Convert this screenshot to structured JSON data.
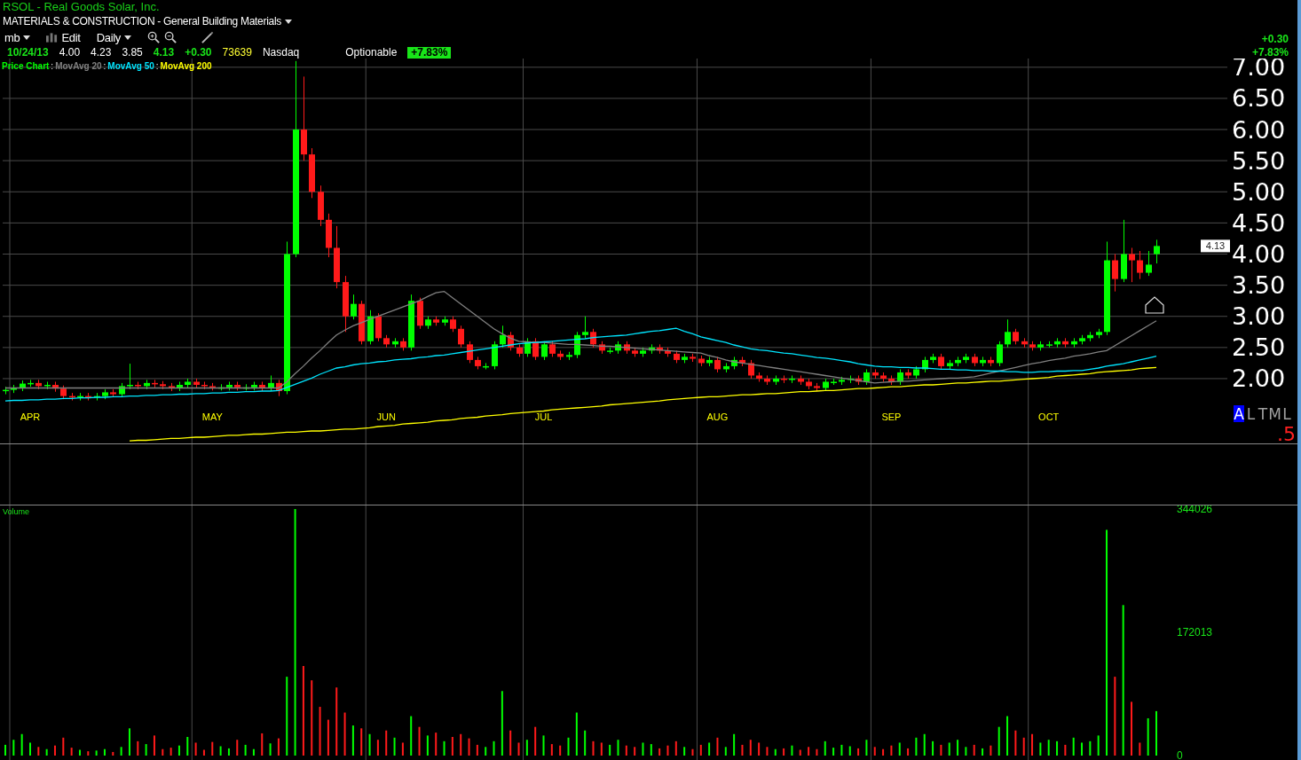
{
  "header": {
    "title": "RSOL - Real Goods Solar, Inc.",
    "sector": "MATERIALS & CONSTRUCTION - General Building Materials"
  },
  "toolbar": {
    "account": "mb",
    "edit": "Edit",
    "period": "Daily"
  },
  "quote": {
    "date": "10/24/13",
    "open": "4.00",
    "high": "4.23",
    "low": "3.85",
    "last": "4.13",
    "change": "+0.30",
    "volume": "73639",
    "exchange": "Nasdaq",
    "optionable": "Optionable",
    "change_pct": "+7.83%"
  },
  "change_box": {
    "change": "+0.30",
    "change_pct": "+7.83%"
  },
  "price_chart": {
    "legend_separator": ":",
    "chart_data": {
      "type": "candlestick",
      "title": "Price Chart",
      "grid": true,
      "ylim": [
        0.96,
        7.14
      ],
      "categories": [
        null,
        null,
        null,
        "APR",
        null,
        null,
        null,
        null,
        null,
        null,
        null,
        null,
        null,
        null,
        null,
        null,
        null,
        null,
        null,
        null,
        null,
        null,
        null,
        null,
        null,
        "MAY",
        null,
        null,
        null,
        null,
        null,
        null,
        null,
        null,
        null,
        null,
        null,
        null,
        null,
        null,
        null,
        null,
        null,
        null,
        null,
        null,
        "JUN",
        null,
        null,
        null,
        null,
        null,
        null,
        null,
        null,
        null,
        null,
        null,
        null,
        null,
        null,
        null,
        null,
        null,
        null,
        "JUL",
        null,
        null,
        null,
        null,
        null,
        null,
        null,
        null,
        null,
        null,
        null,
        null,
        null,
        null,
        null,
        null,
        null,
        null,
        null,
        null,
        "AUG",
        null,
        null,
        null,
        null,
        null,
        null,
        null,
        null,
        null,
        null,
        null,
        null,
        null,
        null,
        null,
        null,
        null,
        null,
        null,
        null,
        "SEP",
        null,
        null,
        null,
        null,
        null,
        null,
        null,
        null,
        null,
        null,
        null,
        null,
        null,
        null,
        null,
        null,
        null,
        null,
        "OCT",
        null,
        null,
        null,
        null,
        null,
        null,
        null,
        null,
        null,
        null,
        null,
        null,
        null
      ],
      "yticks": [
        {
          "value": 2,
          "label": "2.00"
        },
        {
          "value": 2.5,
          "label": "2.50"
        },
        {
          "value": 3,
          "label": "3.00"
        },
        {
          "value": 3.5,
          "label": "3.50"
        },
        {
          "value": 4,
          "label": "4.00"
        },
        {
          "value": 4.5,
          "label": "4.50"
        },
        {
          "value": 5,
          "label": "5.00"
        },
        {
          "value": 5.5,
          "label": "5.50"
        },
        {
          "value": 6,
          "label": "6.00"
        },
        {
          "value": 6.5,
          "label": "6.50"
        },
        {
          "value": 7,
          "label": "7.00"
        }
      ],
      "ohlc": [
        [
          1.8,
          1.87,
          1.75,
          1.82
        ],
        [
          1.82,
          1.9,
          1.77,
          1.85
        ],
        [
          1.85,
          1.97,
          1.8,
          1.92
        ],
        [
          1.92,
          1.98,
          1.87,
          1.93
        ],
        [
          1.93,
          1.98,
          1.83,
          1.88
        ],
        [
          1.88,
          1.95,
          1.83,
          1.9
        ],
        [
          1.9,
          1.95,
          1.79,
          1.84
        ],
        [
          1.84,
          1.89,
          1.67,
          1.72
        ],
        [
          1.72,
          1.77,
          1.65,
          1.7
        ],
        [
          1.7,
          1.77,
          1.65,
          1.72
        ],
        [
          1.72,
          1.77,
          1.65,
          1.7
        ],
        [
          1.7,
          1.77,
          1.65,
          1.72
        ],
        [
          1.72,
          1.83,
          1.67,
          1.78
        ],
        [
          1.78,
          1.83,
          1.7,
          1.75
        ],
        [
          1.75,
          1.93,
          1.7,
          1.88
        ],
        [
          1.88,
          2.24,
          1.83,
          1.9
        ],
        [
          1.9,
          1.95,
          1.83,
          1.88
        ],
        [
          1.88,
          1.98,
          1.83,
          1.93
        ],
        [
          1.93,
          1.98,
          1.86,
          1.91
        ],
        [
          1.91,
          1.96,
          1.83,
          1.88
        ],
        [
          1.88,
          1.93,
          1.8,
          1.85
        ],
        [
          1.85,
          1.95,
          1.8,
          1.9
        ],
        [
          1.9,
          2.0,
          1.85,
          1.95
        ],
        [
          1.95,
          2.0,
          1.85,
          1.9
        ],
        [
          1.9,
          1.95,
          1.83,
          1.88
        ],
        [
          1.88,
          1.93,
          1.81,
          1.86
        ],
        [
          1.86,
          1.91,
          1.81,
          1.86
        ],
        [
          1.86,
          1.95,
          1.81,
          1.9
        ],
        [
          1.9,
          1.95,
          1.81,
          1.86
        ],
        [
          1.86,
          1.91,
          1.81,
          1.86
        ],
        [
          1.86,
          1.95,
          1.81,
          1.9
        ],
        [
          1.9,
          1.95,
          1.8,
          1.85
        ],
        [
          1.85,
          2.05,
          1.8,
          1.93
        ],
        [
          1.93,
          1.98,
          1.72,
          1.8
        ],
        [
          1.8,
          4.2,
          1.75,
          4.0
        ],
        [
          4.0,
          7.1,
          3.95,
          6.0
        ],
        [
          6.0,
          6.85,
          5.5,
          5.6
        ],
        [
          5.6,
          5.7,
          4.9,
          5.0
        ],
        [
          5.0,
          5.1,
          4.45,
          4.55
        ],
        [
          4.55,
          4.65,
          3.95,
          4.1
        ],
        [
          4.1,
          4.45,
          3.45,
          3.55
        ],
        [
          3.55,
          3.65,
          2.75,
          3.0
        ],
        [
          3.0,
          3.35,
          2.95,
          3.2
        ],
        [
          3.2,
          3.25,
          2.55,
          2.6
        ],
        [
          2.6,
          3.1,
          2.55,
          3.0
        ],
        [
          3.0,
          3.05,
          2.6,
          2.65
        ],
        [
          2.65,
          2.7,
          2.5,
          2.55
        ],
        [
          2.55,
          2.65,
          2.5,
          2.6
        ],
        [
          2.6,
          2.65,
          2.45,
          2.5
        ],
        [
          2.5,
          3.35,
          2.45,
          3.25
        ],
        [
          3.25,
          3.3,
          2.8,
          2.85
        ],
        [
          2.85,
          3.0,
          2.8,
          2.95
        ],
        [
          2.95,
          3.0,
          2.85,
          2.9
        ],
        [
          2.9,
          3.0,
          2.85,
          2.95
        ],
        [
          2.95,
          3.0,
          2.75,
          2.8
        ],
        [
          2.8,
          2.85,
          2.5,
          2.55
        ],
        [
          2.55,
          2.6,
          2.25,
          2.3
        ],
        [
          2.3,
          2.35,
          2.15,
          2.2
        ],
        [
          2.2,
          2.25,
          2.15,
          2.2
        ],
        [
          2.2,
          2.6,
          2.15,
          2.55
        ],
        [
          2.55,
          2.85,
          2.5,
          2.7
        ],
        [
          2.7,
          2.75,
          2.45,
          2.5
        ],
        [
          2.5,
          2.55,
          2.35,
          2.4
        ],
        [
          2.4,
          2.65,
          2.35,
          2.6
        ],
        [
          2.6,
          2.65,
          2.3,
          2.35
        ],
        [
          2.35,
          2.6,
          2.3,
          2.55
        ],
        [
          2.55,
          2.6,
          2.35,
          2.4
        ],
        [
          2.4,
          2.45,
          2.3,
          2.35
        ],
        [
          2.35,
          2.43,
          2.3,
          2.38
        ],
        [
          2.38,
          2.75,
          2.33,
          2.7
        ],
        [
          2.7,
          3.0,
          2.65,
          2.75
        ],
        [
          2.75,
          2.8,
          2.5,
          2.55
        ],
        [
          2.55,
          2.6,
          2.4,
          2.45
        ],
        [
          2.45,
          2.5,
          2.4,
          2.45
        ],
        [
          2.45,
          2.6,
          2.4,
          2.55
        ],
        [
          2.55,
          2.6,
          2.4,
          2.45
        ],
        [
          2.45,
          2.5,
          2.35,
          2.4
        ],
        [
          2.4,
          2.5,
          2.35,
          2.45
        ],
        [
          2.45,
          2.55,
          2.4,
          2.5
        ],
        [
          2.5,
          2.55,
          2.4,
          2.45
        ],
        [
          2.45,
          2.5,
          2.35,
          2.4
        ],
        [
          2.4,
          2.45,
          2.25,
          2.3
        ],
        [
          2.3,
          2.4,
          2.25,
          2.35
        ],
        [
          2.35,
          2.4,
          2.27,
          2.32
        ],
        [
          2.32,
          2.37,
          2.2,
          2.25
        ],
        [
          2.25,
          2.35,
          2.2,
          2.3
        ],
        [
          2.3,
          2.35,
          2.1,
          2.15
        ],
        [
          2.15,
          2.25,
          2.1,
          2.2
        ],
        [
          2.2,
          2.35,
          2.15,
          2.3
        ],
        [
          2.3,
          2.35,
          2.2,
          2.25
        ],
        [
          2.25,
          2.3,
          2.0,
          2.05
        ],
        [
          2.05,
          2.1,
          1.95,
          2.0
        ],
        [
          2.0,
          2.05,
          1.9,
          1.95
        ],
        [
          1.95,
          2.05,
          1.9,
          2.0
        ],
        [
          2.0,
          2.05,
          1.93,
          1.98
        ],
        [
          1.98,
          2.05,
          1.93,
          2.0
        ],
        [
          2.0,
          2.05,
          1.9,
          1.95
        ],
        [
          1.95,
          2.0,
          1.83,
          1.88
        ],
        [
          1.88,
          1.93,
          1.8,
          1.85
        ],
        [
          1.85,
          2.0,
          1.8,
          1.95
        ],
        [
          1.95,
          2.0,
          1.9,
          1.95
        ],
        [
          1.95,
          2.03,
          1.9,
          1.98
        ],
        [
          1.98,
          2.05,
          1.93,
          2.0
        ],
        [
          2.0,
          2.05,
          1.9,
          1.95
        ],
        [
          1.95,
          2.15,
          1.9,
          2.1
        ],
        [
          2.1,
          2.15,
          2.0,
          2.05
        ],
        [
          2.05,
          2.1,
          1.95,
          2.0
        ],
        [
          2.0,
          2.05,
          1.9,
          1.95
        ],
        [
          1.95,
          2.15,
          1.9,
          2.1
        ],
        [
          2.1,
          2.15,
          2.0,
          2.05
        ],
        [
          2.05,
          2.2,
          2.0,
          2.15
        ],
        [
          2.15,
          2.35,
          2.1,
          2.3
        ],
        [
          2.3,
          2.4,
          2.25,
          2.35
        ],
        [
          2.35,
          2.4,
          2.15,
          2.2
        ],
        [
          2.2,
          2.3,
          2.15,
          2.25
        ],
        [
          2.25,
          2.35,
          2.2,
          2.3
        ],
        [
          2.3,
          2.4,
          2.25,
          2.35
        ],
        [
          2.35,
          2.4,
          2.2,
          2.25
        ],
        [
          2.25,
          2.35,
          2.2,
          2.3
        ],
        [
          2.3,
          2.35,
          2.2,
          2.25
        ],
        [
          2.25,
          2.6,
          2.2,
          2.55
        ],
        [
          2.55,
          2.95,
          2.5,
          2.75
        ],
        [
          2.75,
          2.8,
          2.55,
          2.6
        ],
        [
          2.6,
          2.65,
          2.5,
          2.55
        ],
        [
          2.55,
          2.6,
          2.45,
          2.5
        ],
        [
          2.5,
          2.6,
          2.45,
          2.55
        ],
        [
          2.55,
          2.6,
          2.5,
          2.55
        ],
        [
          2.55,
          2.65,
          2.5,
          2.6
        ],
        [
          2.6,
          2.65,
          2.5,
          2.55
        ],
        [
          2.55,
          2.65,
          2.5,
          2.6
        ],
        [
          2.6,
          2.7,
          2.55,
          2.65
        ],
        [
          2.65,
          2.75,
          2.6,
          2.7
        ],
        [
          2.7,
          2.8,
          2.65,
          2.75
        ],
        [
          2.75,
          4.2,
          2.7,
          3.9
        ],
        [
          3.9,
          4.0,
          3.4,
          3.6
        ],
        [
          3.6,
          4.55,
          3.55,
          4.0
        ],
        [
          4.0,
          4.1,
          3.55,
          3.9
        ],
        [
          3.9,
          4.05,
          3.6,
          3.7
        ],
        [
          3.7,
          4.05,
          3.65,
          3.83
        ],
        [
          4.0,
          4.23,
          3.85,
          4.13
        ]
      ],
      "series": [
        {
          "name": "MovAvg 20",
          "type": "line",
          "color": "#808080",
          "values": [
            1.85,
            1.85,
            1.85,
            1.85,
            1.85,
            1.85,
            1.85,
            1.85,
            1.85,
            1.85,
            1.85,
            1.85,
            1.85,
            1.85,
            1.85,
            1.85,
            1.85,
            1.85,
            1.85,
            1.85,
            1.85,
            1.85,
            1.85,
            1.85,
            1.85,
            1.85,
            1.85,
            1.85,
            1.85,
            1.85,
            1.85,
            1.85,
            1.85,
            1.85,
            1.95,
            2.08,
            2.2,
            2.33,
            2.45,
            2.58,
            2.7,
            2.78,
            2.85,
            2.9,
            2.95,
            3.0,
            3.05,
            3.1,
            3.15,
            3.2,
            3.25,
            3.32,
            3.38,
            3.4,
            3.3,
            3.2,
            3.1,
            3.0,
            2.9,
            2.8,
            2.72,
            2.65,
            2.6,
            2.59,
            2.58,
            2.58,
            2.57,
            2.56,
            2.55,
            2.55,
            2.54,
            2.53,
            2.52,
            2.52,
            2.51,
            2.5,
            2.49,
            2.48,
            2.47,
            2.46,
            2.45,
            2.44,
            2.43,
            2.42,
            2.41,
            2.37,
            2.34,
            2.3,
            2.27,
            2.25,
            2.23,
            2.21,
            2.19,
            2.17,
            2.15,
            2.13,
            2.11,
            2.09,
            2.07,
            2.05,
            2.03,
            2.01,
            1.99,
            1.97,
            1.95,
            1.93,
            1.94,
            1.95,
            1.96,
            1.96,
            1.97,
            1.98,
            1.99,
            2.0,
            2.01,
            2.01,
            2.02,
            2.03,
            2.06,
            2.09,
            2.12,
            2.15,
            2.18,
            2.21,
            2.24,
            2.26,
            2.29,
            2.31,
            2.33,
            2.36,
            2.38,
            2.4,
            2.43,
            2.45,
            2.53,
            2.61,
            2.69,
            2.77,
            2.85,
            2.93
          ]
        },
        {
          "name": "MovAvg 50",
          "type": "line",
          "color": "#00e5ff",
          "values": [
            1.64,
            1.65,
            1.65,
            1.66,
            1.66,
            1.67,
            1.67,
            1.68,
            1.68,
            1.69,
            1.69,
            1.7,
            1.7,
            1.71,
            1.71,
            1.72,
            1.72,
            1.73,
            1.73,
            1.74,
            1.74,
            1.75,
            1.75,
            1.76,
            1.76,
            1.77,
            1.77,
            1.78,
            1.78,
            1.79,
            1.79,
            1.8,
            1.8,
            1.81,
            1.86,
            1.91,
            1.96,
            2.01,
            2.07,
            2.12,
            2.17,
            2.19,
            2.22,
            2.24,
            2.25,
            2.27,
            2.28,
            2.3,
            2.31,
            2.32,
            2.34,
            2.35,
            2.37,
            2.38,
            2.4,
            2.42,
            2.44,
            2.46,
            2.48,
            2.5,
            2.52,
            2.54,
            2.56,
            2.57,
            2.58,
            2.59,
            2.6,
            2.61,
            2.62,
            2.63,
            2.64,
            2.66,
            2.67,
            2.68,
            2.69,
            2.7,
            2.72,
            2.74,
            2.76,
            2.77,
            2.79,
            2.81,
            2.76,
            2.72,
            2.67,
            2.64,
            2.61,
            2.58,
            2.54,
            2.51,
            2.48,
            2.46,
            2.45,
            2.43,
            2.41,
            2.4,
            2.38,
            2.36,
            2.34,
            2.33,
            2.31,
            2.29,
            2.27,
            2.24,
            2.22,
            2.2,
            2.19,
            2.19,
            2.18,
            2.18,
            2.17,
            2.17,
            2.16,
            2.15,
            2.15,
            2.14,
            2.14,
            2.13,
            2.13,
            2.12,
            2.12,
            2.11,
            2.11,
            2.1,
            2.1,
            2.11,
            2.11,
            2.12,
            2.12,
            2.13,
            2.13,
            2.15,
            2.17,
            2.2,
            2.22,
            2.24,
            2.27,
            2.3,
            2.33,
            2.36
          ]
        },
        {
          "name": "MovAvg 200",
          "type": "line",
          "color": "#ffff00",
          "values": [
            null,
            null,
            null,
            null,
            null,
            null,
            null,
            null,
            null,
            null,
            null,
            null,
            null,
            null,
            null,
            1.0,
            1.01,
            1.01,
            1.02,
            1.03,
            1.04,
            1.04,
            1.05,
            1.06,
            1.06,
            1.07,
            1.08,
            1.09,
            1.09,
            1.1,
            1.11,
            1.11,
            1.12,
            1.13,
            1.14,
            1.14,
            1.15,
            1.16,
            1.16,
            1.17,
            1.18,
            1.19,
            1.19,
            1.2,
            1.21,
            1.23,
            1.24,
            1.25,
            1.27,
            1.28,
            1.29,
            1.3,
            1.32,
            1.33,
            1.34,
            1.36,
            1.37,
            1.38,
            1.4,
            1.41,
            1.42,
            1.44,
            1.45,
            1.46,
            1.47,
            1.48,
            1.5,
            1.51,
            1.52,
            1.53,
            1.54,
            1.55,
            1.56,
            1.58,
            1.59,
            1.6,
            1.61,
            1.62,
            1.63,
            1.64,
            1.66,
            1.67,
            1.68,
            1.69,
            1.7,
            1.71,
            1.71,
            1.72,
            1.73,
            1.74,
            1.74,
            1.75,
            1.76,
            1.76,
            1.77,
            1.78,
            1.79,
            1.79,
            1.8,
            1.81,
            1.81,
            1.82,
            1.83,
            1.84,
            1.84,
            1.85,
            1.86,
            1.87,
            1.87,
            1.88,
            1.89,
            1.9,
            1.9,
            1.91,
            1.92,
            1.93,
            1.93,
            1.94,
            1.95,
            1.96,
            1.96,
            1.97,
            1.98,
            1.99,
            2.0,
            2.01,
            2.02,
            2.04,
            2.05,
            2.06,
            2.07,
            2.08,
            2.1,
            2.11,
            2.12,
            2.13,
            2.14,
            2.16,
            2.17,
            2.18
          ]
        }
      ]
    },
    "price_tag": "4.13",
    "scale_buttons": [
      {
        "label": "A",
        "selected": true
      },
      {
        "label": "L",
        "selected": false
      },
      {
        "label": "T",
        "selected": false
      },
      {
        "label": "M",
        "selected": false
      },
      {
        "label": "L",
        "selected": false
      }
    ],
    "zoom_level": ".5"
  },
  "volume_chart": {
    "chart_data": {
      "type": "bar",
      "title": "Volume",
      "ylim": [
        0,
        344026
      ],
      "yticks": [
        0,
        172013,
        344026
      ],
      "categories": [
        null,
        null,
        null,
        null,
        null,
        null,
        null,
        null,
        null,
        null,
        null,
        null,
        null,
        null,
        null,
        null,
        null,
        null,
        null,
        null,
        null,
        null,
        null,
        null,
        null,
        null,
        null,
        null,
        null,
        null,
        null,
        null,
        null,
        null,
        null,
        null,
        null,
        null,
        null,
        null,
        null,
        null,
        null,
        null,
        null,
        null,
        null,
        null,
        null,
        null,
        null,
        null,
        null,
        null,
        null,
        null,
        null,
        null,
        null,
        null,
        null,
        null,
        null,
        null,
        null,
        null,
        null,
        null,
        null,
        null,
        null,
        null,
        null,
        null,
        null,
        null,
        null,
        null,
        null,
        null,
        null,
        null,
        null,
        null,
        null,
        null,
        null,
        null,
        null,
        null,
        null,
        null,
        null,
        null,
        null,
        null,
        null,
        null,
        null,
        null,
        null,
        null,
        null,
        null,
        null,
        null,
        null,
        null,
        null,
        null,
        null,
        null,
        null,
        null,
        null,
        null,
        null,
        null,
        null,
        null,
        null,
        null,
        null,
        null,
        null,
        null,
        null,
        null,
        null,
        null,
        null,
        null,
        null,
        null,
        null,
        null,
        null,
        null,
        null,
        null
      ],
      "values": [
        15000,
        22000,
        30000,
        18000,
        12000,
        9000,
        14000,
        25000,
        11000,
        8000,
        6000,
        7000,
        9000,
        5000,
        12000,
        38000,
        20000,
        16000,
        28000,
        9000,
        11000,
        14000,
        26000,
        18000,
        8000,
        19000,
        13000,
        10000,
        22000,
        15000,
        9000,
        31000,
        17000,
        24000,
        110000,
        344026,
        125000,
        105000,
        68000,
        50000,
        95000,
        60000,
        42000,
        38000,
        30000,
        22000,
        35000,
        25000,
        18000,
        55000,
        40000,
        28000,
        32000,
        20000,
        26000,
        30000,
        24000,
        15000,
        12000,
        20000,
        90000,
        35000,
        18000,
        22000,
        40000,
        28000,
        16000,
        14000,
        25000,
        60000,
        35000,
        20000,
        18000,
        15000,
        22000,
        14000,
        12000,
        18000,
        16000,
        10000,
        14000,
        20000,
        12000,
        9000,
        15000,
        18000,
        25000,
        12000,
        30000,
        15000,
        22000,
        18000,
        12000,
        9000,
        10000,
        14000,
        8000,
        12000,
        9000,
        20000,
        11000,
        15000,
        13000,
        10000,
        22000,
        12000,
        9000,
        14000,
        18000,
        10000,
        25000,
        30000,
        20000,
        15000,
        18000,
        22000,
        12000,
        15000,
        10000,
        14000,
        40000,
        55000,
        35000,
        25000,
        30000,
        18000,
        22000,
        20000,
        15000,
        25000,
        18000,
        20000,
        28000,
        315000,
        110000,
        210000,
        75000,
        18000,
        52000,
        62000
      ]
    }
  }
}
